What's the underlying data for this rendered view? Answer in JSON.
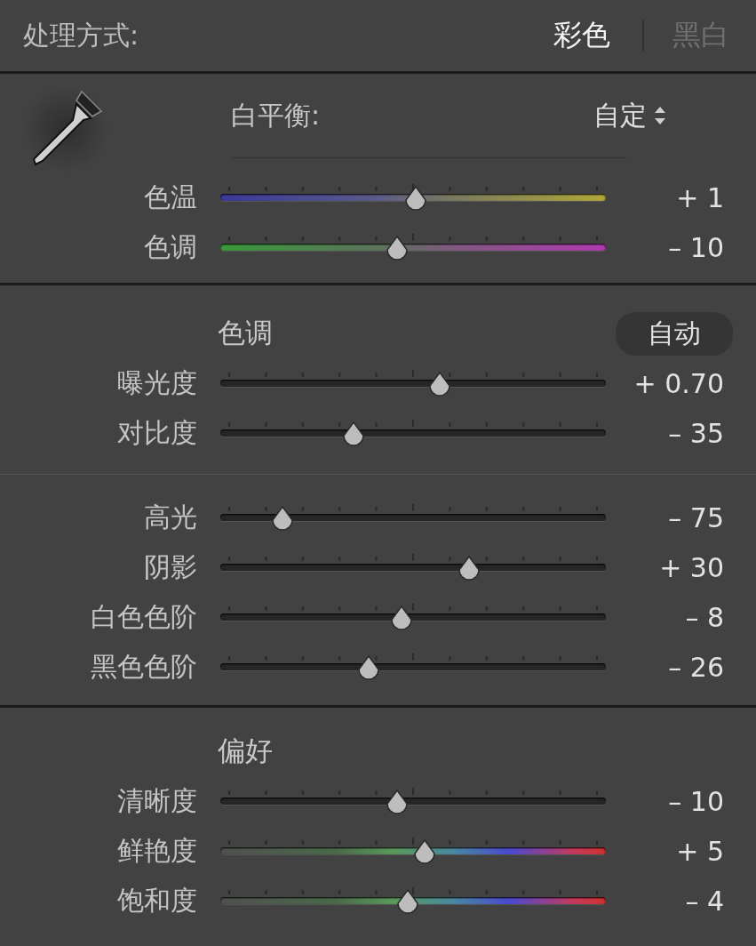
{
  "treatment": {
    "label": "处理方式:",
    "options": [
      {
        "label": "彩色",
        "selected": true
      },
      {
        "label": "黑白",
        "selected": false
      }
    ]
  },
  "white_balance": {
    "label": "白平衡:",
    "value": "自定",
    "sliders": [
      {
        "label": "色温",
        "kind": "temp",
        "level": 0.507,
        "reading": "+ 1"
      },
      {
        "label": "色调",
        "kind": "tint",
        "level": 0.458,
        "reading": "– 10"
      }
    ]
  },
  "tone": {
    "heading": "色调",
    "auto_button": "自动",
    "groups": [
      [
        {
          "label": "曝光度",
          "kind": "plain",
          "level": 0.569,
          "reading": "+ 0.70"
        },
        {
          "label": "对比度",
          "kind": "plain",
          "level": 0.346,
          "reading": "– 35"
        }
      ],
      [
        {
          "label": "高光",
          "kind": "plain",
          "level": 0.161,
          "reading": "– 75"
        },
        {
          "label": "阴影",
          "kind": "plain",
          "level": 0.645,
          "reading": "+ 30"
        },
        {
          "label": "白色色阶",
          "kind": "plain",
          "level": 0.47,
          "reading": "– 8"
        },
        {
          "label": "黑色色阶",
          "kind": "plain",
          "level": 0.385,
          "reading": "– 26"
        }
      ]
    ]
  },
  "presence": {
    "heading": "偏好",
    "sliders": [
      {
        "label": "清晰度",
        "kind": "plain",
        "level": 0.458,
        "reading": "– 10"
      },
      {
        "label": "鲜艳度",
        "kind": "vibrance",
        "level": 0.53,
        "reading": "+ 5"
      },
      {
        "label": "饱和度",
        "kind": "saturation",
        "level": 0.486,
        "reading": "– 4"
      }
    ]
  }
}
